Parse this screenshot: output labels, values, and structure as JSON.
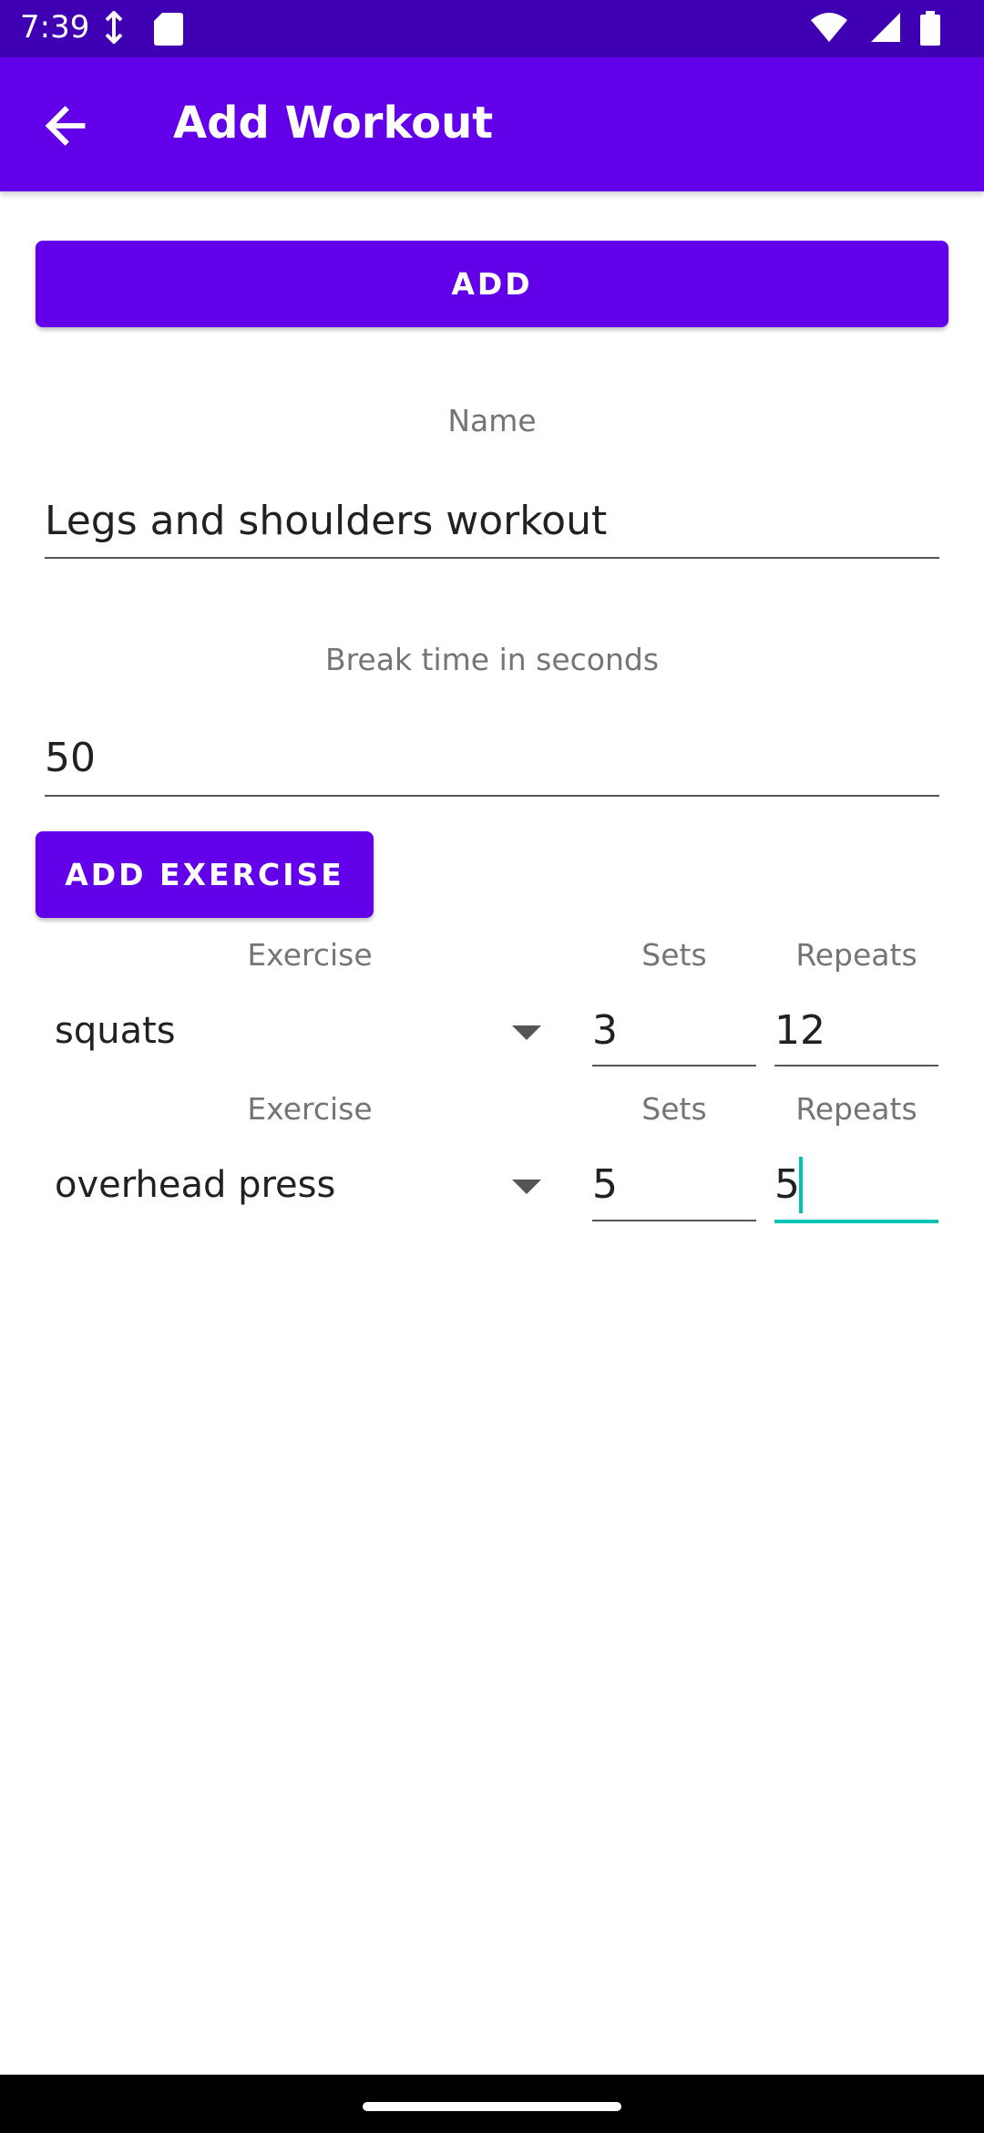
{
  "status_bar": {
    "time": "7:39"
  },
  "app_bar": {
    "title": "Add Workout",
    "back_icon": "arrow-back-icon"
  },
  "form": {
    "add_button_label": "ADD",
    "name_label": "Name",
    "name_value": "Legs and shoulders workout",
    "break_label": "Break time in seconds",
    "break_value": "50",
    "add_exercise_label": "ADD EXERCISE"
  },
  "exercises": [
    {
      "exercise_header": "Exercise",
      "sets_header": "Sets",
      "repeats_header": "Repeats",
      "exercise": "squats",
      "sets": "3",
      "repeats": "12"
    },
    {
      "exercise_header": "Exercise",
      "sets_header": "Sets",
      "repeats_header": "Repeats",
      "exercise": "overhead press",
      "sets": "5",
      "repeats": "5"
    }
  ],
  "colors": {
    "primary": "#6200ea",
    "status_bar": "#3f00b4",
    "accent": "#00c3b0"
  }
}
